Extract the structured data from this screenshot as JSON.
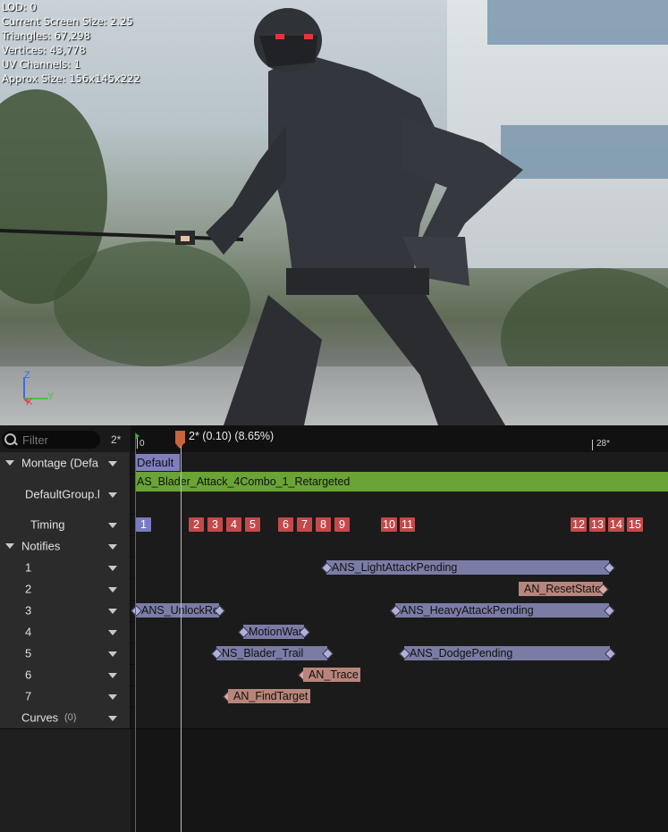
{
  "viewport": {
    "stats": {
      "lod": "LOD: 0",
      "screen_size": "Current Screen Size: 2.25",
      "triangles": "Triangles: 67,298",
      "vertices": "Vertices: 43,778",
      "uv_channels": "UV Channels: 1",
      "approx_size": "Approx Size: 156x145x222"
    },
    "axis": {
      "z": "Z",
      "x": "X",
      "y": "Y"
    }
  },
  "header": {
    "filter_placeholder": "Filter",
    "frame_badge": "2*",
    "scrub_label": "2* (0.10) (8.65%)",
    "ruler_start": "0",
    "ruler_end": "28*"
  },
  "rows": {
    "montage": "Montage (Defa",
    "section_name": "Default",
    "slot_label": "DefaultGroup.l",
    "segment_name": "AS_Blader_Attack_4Combo_1_Retargeted",
    "timing": "Timing",
    "notifies": "Notifies",
    "tracks": [
      "1",
      "2",
      "3",
      "4",
      "5",
      "6",
      "7"
    ],
    "curves": "Curves",
    "curves_count": "(0)"
  },
  "timing_markers": [
    "1",
    "2",
    "3",
    "4",
    "5",
    "6",
    "7",
    "8",
    "9",
    "10",
    "11",
    "12",
    "13",
    "14",
    "15"
  ],
  "notifies": {
    "light": "ANS_LightAttackPending",
    "reset": "AN_ResetState",
    "unlock": "ANS_UnlockRo",
    "heavy": "ANS_HeavyAttackPending",
    "motion": "MotionWar",
    "trail": "NS_Blader_Trail",
    "dodge": "ANS_DodgePending",
    "trace": "AN_Trace",
    "find": "AN_FindTarget"
  },
  "colors": {
    "segment_green": "#6aa336",
    "section_purple": "#7f7fbf",
    "marker_red": "#c34a4a",
    "notify_state": "#7b7ca6",
    "notify_single": "#b8857b"
  }
}
